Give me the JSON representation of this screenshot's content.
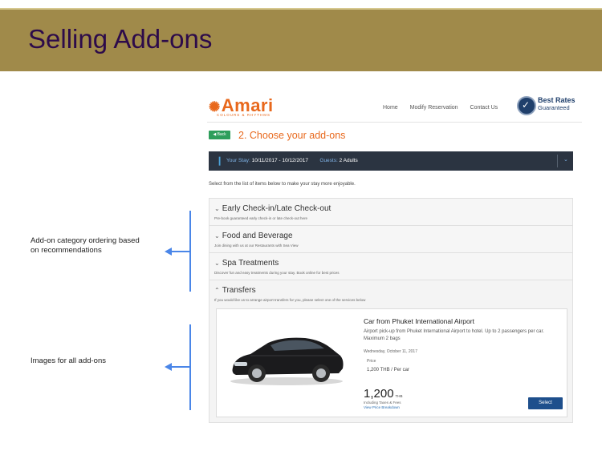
{
  "slide": {
    "title": "Selling Add-ons"
  },
  "annotations": {
    "ordering": "Add-on category ordering based on recommendations",
    "images": "Images for all add-ons"
  },
  "site": {
    "logo": "Amari",
    "logo_tagline": "COLOURS & RHYTHMS",
    "nav": [
      "Home",
      "Modify Reservation",
      "Contact Us"
    ],
    "badge": {
      "line1": "Best Rates",
      "line2": "Guaranteed"
    }
  },
  "step": {
    "back_label": "Back",
    "title": "2. Choose your add-ons"
  },
  "stay": {
    "stay_label": "Your Stay:",
    "stay_dates": "10/11/2017 - 10/12/2017",
    "guests_label": "Guests:",
    "guests_value": "2 Adults"
  },
  "intro": "Select from the list of items below to make your stay more enjoyable.",
  "categories": [
    {
      "title": "Early Check-in/Late Check-out",
      "subtitle": "Pre-book guaranteed early check-in or late check-out here",
      "expanded": false
    },
    {
      "title": "Food and Beverage",
      "subtitle": "Join dining with us at our Restaurants with Sea View",
      "expanded": false
    },
    {
      "title": "Spa Treatments",
      "subtitle": "Discover fun and easy treatments during your stay. Book online for best prices",
      "expanded": false
    },
    {
      "title": "Transfers",
      "subtitle": "If you would like us to arrange airport transfers for you, please select one of the services below",
      "expanded": true
    }
  ],
  "transfer_card": {
    "title": "Car from Phuket International Airport",
    "description": "Airport pick-up from Phuket International Airport to hotel. Up to 2 passengers per car. Maximum 2 bags",
    "date": "Wednesday, October 11, 2017",
    "price_label": "Price",
    "price_unit": "1,200 THB / Per car",
    "price_total": "1,200",
    "currency": "THB",
    "taxes_note": "Including Taxes & Fees",
    "breakdown_link": "View Price Breakdown",
    "select_label": "Select"
  },
  "colors": {
    "header_gold": "#a08a4a",
    "title_purple": "#2d0b4a",
    "brand_orange": "#e8681c",
    "arrow_blue": "#4a86e8",
    "stay_bar": "#2b3441",
    "select_blue": "#1e4f8c"
  }
}
